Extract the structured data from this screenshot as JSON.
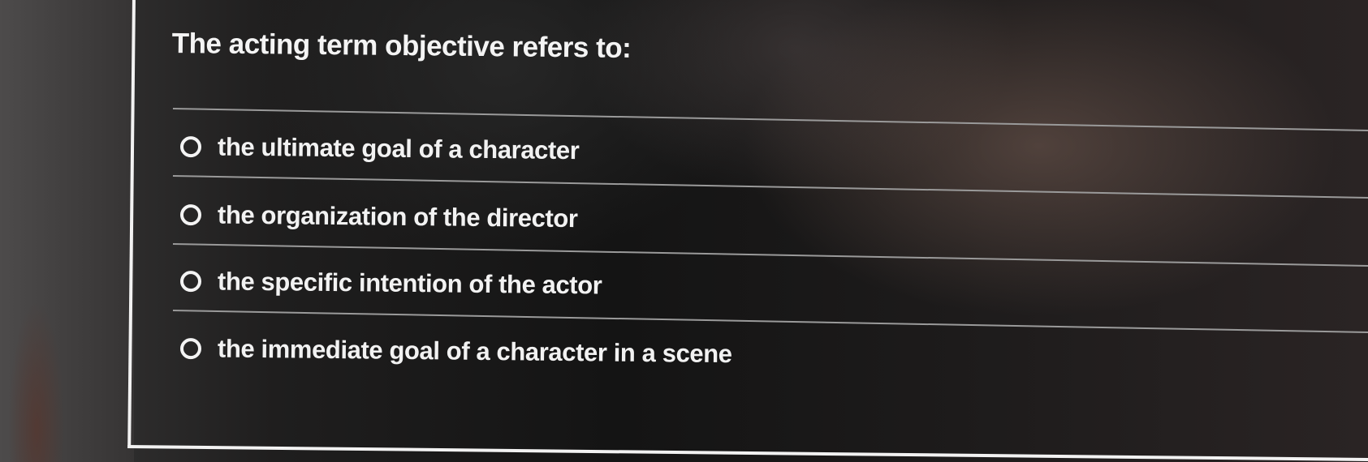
{
  "question": {
    "text": "The acting term objective refers to:"
  },
  "options": [
    {
      "label": "the ultimate goal of a character",
      "selected": false
    },
    {
      "label": "the organization of the director",
      "selected": false
    },
    {
      "label": "the specific intention of the actor",
      "selected": false
    },
    {
      "label": "the immediate goal of a character in a scene",
      "selected": false
    }
  ],
  "icons": {
    "radio": "radio-unselected-icon"
  },
  "colors": {
    "background": "#1a1a1a",
    "text": "#f2f2f2",
    "divider": "#9a9a9a"
  }
}
